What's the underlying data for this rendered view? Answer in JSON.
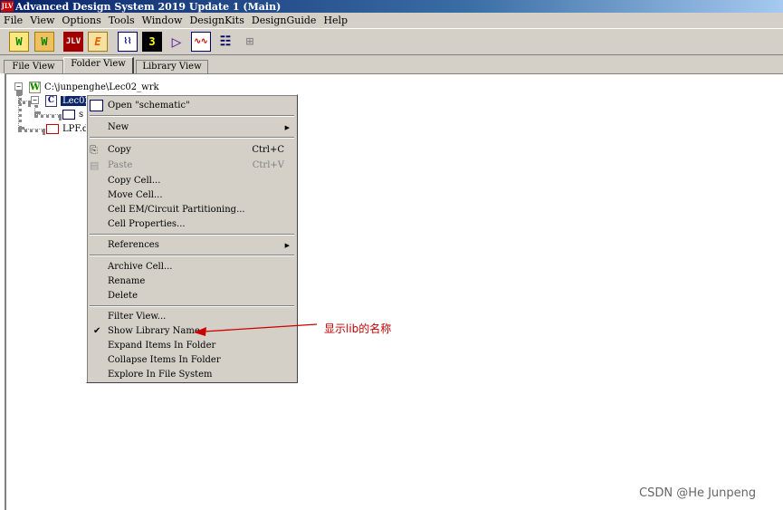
{
  "window": {
    "title": "Advanced Design System 2019 Update 1 (Main)"
  },
  "menubar": [
    "File",
    "View",
    "Options",
    "Tools",
    "Window",
    "DesignKits",
    "DesignGuide",
    "Help"
  ],
  "toolbar_icons": [
    "new-workspace-icon",
    "open-workspace-icon",
    "ads-logo-icon",
    "em-icon",
    "schematic-icon",
    "run-icon",
    "play-icon",
    "data-display-icon",
    "library-icon",
    "hierarchy-icon"
  ],
  "tabs": [
    "File View",
    "Folder View",
    "Library View"
  ],
  "active_tab": "Folder View",
  "tree": {
    "root": "C:\\junpenghe\\Lec02_wrk",
    "cell": "Lec02",
    "child": "s",
    "file": "LPF.d"
  },
  "context_menu": {
    "open": "Open \"schematic\"",
    "new": "New",
    "copy": "Copy",
    "copy_shortcut": "Ctrl+C",
    "paste": "Paste",
    "paste_shortcut": "Ctrl+V",
    "copy_cell": "Copy Cell...",
    "move_cell": "Move Cell...",
    "cell_em": "Cell EM/Circuit Partitioning...",
    "cell_props": "Cell Properties...",
    "references": "References",
    "archive_cell": "Archive Cell...",
    "rename": "Rename",
    "delete": "Delete",
    "filter_view": "Filter View...",
    "show_lib_name": "Show Library Name",
    "show_lib_name_checked": true,
    "expand_items": "Expand Items In Folder",
    "collapse_items": "Collapse Items In Folder",
    "explore": "Explore In File System"
  },
  "annotation": {
    "text": "显示lib的名称",
    "color": "#cc0000"
  },
  "watermark": "CSDN @He Junpeng"
}
